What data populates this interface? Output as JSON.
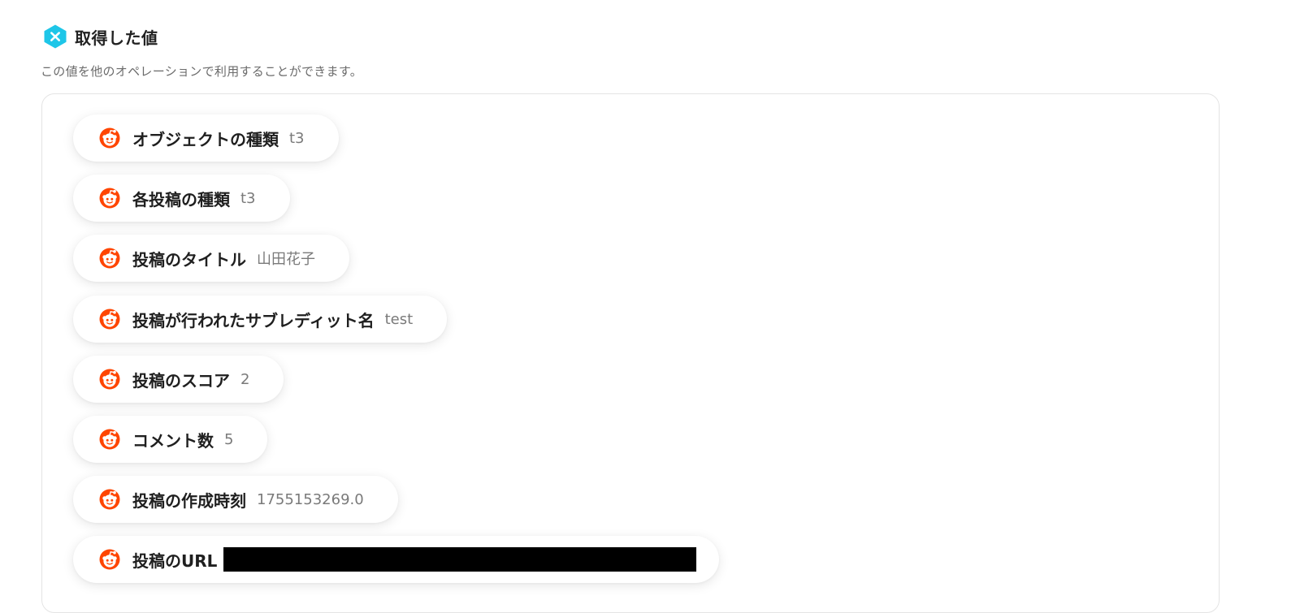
{
  "header": {
    "title": "取得した値",
    "icon": "yoom-logo-icon",
    "icon_color": "#1ec6e8"
  },
  "subtitle": "この値を他のオペレーションで利用することができます。",
  "chip_icon": "reddit-icon",
  "reddit_color": "#ff4500",
  "values": [
    {
      "label": "オブジェクトの種類",
      "value": "t3"
    },
    {
      "label": "各投稿の種類",
      "value": "t3"
    },
    {
      "label": "投稿のタイトル",
      "value": "山田花子"
    },
    {
      "label": "投稿が行われたサブレディット名",
      "value": "test"
    },
    {
      "label": "投稿のスコア",
      "value": "2"
    },
    {
      "label": "コメント数",
      "value": "5"
    },
    {
      "label": "投稿の作成時刻",
      "value": "1755153269.0"
    },
    {
      "label": "投稿のURL",
      "value": "",
      "redacted": true
    }
  ]
}
